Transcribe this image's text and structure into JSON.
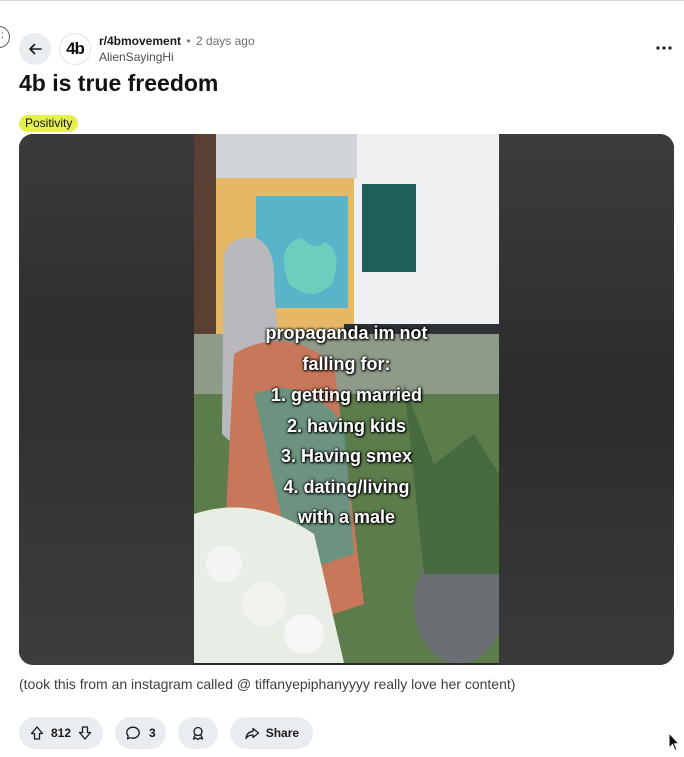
{
  "post": {
    "subreddit": "r/4bmovement",
    "separator": "•",
    "time": "2 days ago",
    "author": "AlienSayingHi",
    "title": "4b is true freedom",
    "flair": "Positivity",
    "avatar_text": "4b",
    "body": "(took this from an instagram called @ tiffanyepiphanyyyy really love her content)"
  },
  "media": {
    "overlay_lines": [
      "propaganda im not",
      "falling for:",
      "1. getting married",
      "2. having kids",
      "3. Having smex",
      "4. dating/living",
      "with a male"
    ]
  },
  "actions": {
    "upvotes": "812",
    "comments": "3",
    "share_label": "Share"
  },
  "icons": {
    "back": "arrow-left-icon",
    "more": "ellipsis-icon",
    "upvote": "arrow-up-icon",
    "downvote": "arrow-down-icon",
    "comment": "speech-bubble-icon",
    "award": "award-icon",
    "share": "share-arrow-icon"
  },
  "colors": {
    "flair_bg": "#e7f04a",
    "pill_bg": "#eaedef"
  }
}
